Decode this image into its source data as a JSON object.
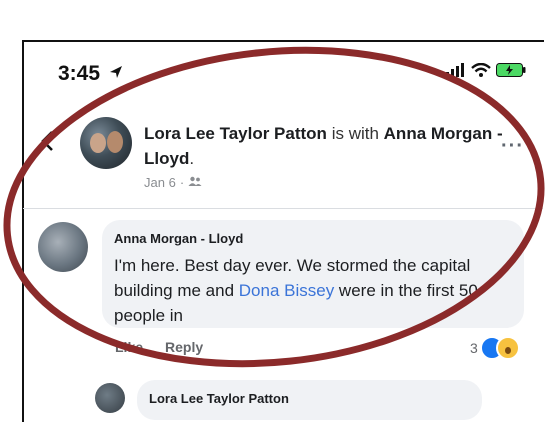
{
  "status_bar": {
    "time": "3:45"
  },
  "post": {
    "author": "Lora Lee Taylor Patton",
    "with_text": "is with",
    "tagged": "Anna Morgan - Lloyd",
    "period": ".",
    "date": "Jan 6",
    "separator": "·",
    "more": "···"
  },
  "comment": {
    "author": "Anna Morgan - Lloyd",
    "text_before_link": "I'm here. Best day ever. We stormed the capital building me and ",
    "link": "Dona Bissey",
    "text_after_link": " were in the first 50 people in",
    "like_label": "Like",
    "reply_label": "Reply",
    "reaction_count": "3"
  },
  "reply": {
    "author": "Lora Lee Taylor Patton"
  },
  "colors": {
    "annotation": "#8b2a2a",
    "link": "#3b74d8",
    "bubble": "#f0f2f5"
  },
  "icons": [
    "location-arrow-icon",
    "signal-icon",
    "wifi-icon",
    "battery-icon",
    "back-arrow-icon",
    "friends-icon",
    "like-reaction-icon",
    "wow-reaction-icon"
  ]
}
